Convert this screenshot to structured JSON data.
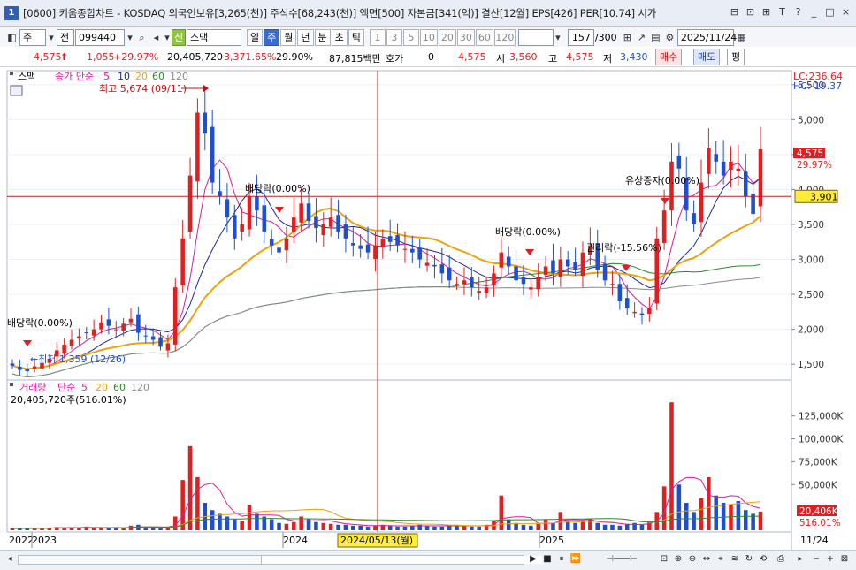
{
  "window": {
    "badge": "1",
    "title": "[0600] 키움종합차트 - KOSDAQ 외국인보유[3,265(천)] 주식수[68,243(천)] 액면[500] 자본금[341(억)] 결산[12월] EPS[426] PER[10.74] 시가",
    "buttons": [
      "⊟",
      "⊡",
      "⊞",
      "T",
      "?",
      "_",
      "□",
      "×"
    ]
  },
  "toolbar": {
    "period_mode": "주",
    "prev_label": "전",
    "stock_code": "099440",
    "credit_label": "신",
    "stock_name": "스맥",
    "period_buttons": [
      "일",
      "주",
      "월",
      "년",
      "분",
      "초",
      "틱"
    ],
    "selected_period": "주",
    "intervals": [
      "1",
      "3",
      "5",
      "10",
      "20",
      "30",
      "60",
      "120"
    ],
    "count": "157",
    "count_total": "/300",
    "date": "2025/11/24"
  },
  "quote": {
    "price": "4,575",
    "change": "1,055",
    "change_pct": "+29.97%",
    "volume": "20,405,720",
    "volume_pct": "3,371.65%",
    "turnover": "29.90%",
    "amount": "87,815백만",
    "hoga_label": "호가",
    "hoga_value": "0",
    "hoga_price": "4,575",
    "open_label": "시",
    "open": "3,560",
    "high_label": "고",
    "high": "4,575",
    "low_label": "저",
    "low": "3,430",
    "buy_label": "매수",
    "sell_label": "매도",
    "eval_label": "평"
  },
  "price_panel": {
    "stock_tag": "스맥",
    "legend_label": "종가 단순",
    "ma_labels": [
      "5",
      "10",
      "20",
      "60",
      "120"
    ],
    "ma_colors": [
      "#d81b9c",
      "#1b2a99",
      "#e8a410",
      "#2a8a2a",
      "#8a8a8a"
    ],
    "lc": "LC:236.64",
    "hc": "HC:-19.37",
    "axis_labels": [
      "5,500",
      "5,000",
      "4,500",
      "4,000",
      "3,500",
      "3,000",
      "2,500",
      "2,000",
      "1,500"
    ],
    "axis_values": [
      5500,
      5000,
      4500,
      4000,
      3500,
      3000,
      2500,
      2000,
      1500
    ],
    "current_price_label": "4,575",
    "current_pct_label": "29.97%",
    "crosshair_price_label": "3,901",
    "crosshair_price": 3901,
    "high_annotation": "최고 5,674 (09/11)",
    "low_annotation": "←최저 1,359 (12/26)",
    "events": [
      "배당락(0.00%)",
      "배당락(0.00%)",
      "배당락(0.00%)",
      "권리락(-15.56%)",
      "유상증자(0.00%)"
    ]
  },
  "volume_panel": {
    "legend_label": "거래량",
    "legend_sub": "단순",
    "ma_labels": [
      "5",
      "20",
      "60",
      "120"
    ],
    "ma_colors": [
      "#d81b9c",
      "#e8a410",
      "#2a8a2a",
      "#8a8a8a"
    ],
    "volume_text": "20,405,720주(516.01%)",
    "axis_labels": [
      "125,000K",
      "100,000K",
      "75,000K",
      "50,000K"
    ],
    "axis_values": [
      125000,
      100000,
      75000,
      50000
    ],
    "current_volume_label": "20,406K",
    "current_pct_label": "516.01%"
  },
  "x_axis": {
    "labels": [
      "2022",
      "2023",
      "2024",
      "2025"
    ],
    "crosshair_date": "2024/05/13(월)",
    "right_label": "11/24"
  },
  "chart_data": {
    "type": "candlestick",
    "interval": "weekly",
    "x_range": [
      "2022-12",
      "2025-11-24"
    ],
    "ylim": [
      1300,
      5700
    ],
    "series": [
      {
        "name": "종가",
        "close": [
          1480,
          1420,
          1400,
          1470,
          1520,
          1580,
          1700,
          1780,
          1850,
          1900,
          1950,
          2000,
          2100,
          2050,
          2000,
          2080,
          2150,
          1950,
          1900,
          1850,
          1750,
          1800,
          2600,
          3300,
          4200,
          5100,
          4800,
          4100,
          3900,
          3600,
          3300,
          3500,
          3900,
          3700,
          3400,
          3200,
          3100,
          3300,
          3600,
          3800,
          3550,
          3450,
          3500,
          3600,
          3400,
          3300,
          3200,
          3150,
          3100,
          3200,
          3300,
          3250,
          3200,
          3150,
          3100,
          3000,
          2950,
          2900,
          2800,
          2700,
          2650,
          2700,
          2600,
          2550,
          2600,
          2800,
          3100,
          2900,
          2700,
          2650,
          2600,
          2750,
          2900,
          2800,
          3000,
          2900,
          2850,
          3100,
          3200,
          2850,
          2700,
          2650,
          2400,
          2300,
          2250,
          2200,
          2300,
          3300,
          3700,
          4400,
          4300,
          3700,
          3500,
          4100,
          4600,
          4400,
          4200,
          4400,
          4300,
          3900,
          3650,
          4575
        ]
      },
      {
        "name": "거래량",
        "unit": "K",
        "values": [
          2000,
          1800,
          2200,
          2500,
          2400,
          3000,
          3500,
          2800,
          2600,
          2400,
          4000,
          3000,
          2800,
          2500,
          2600,
          2400,
          5000,
          6000,
          3000,
          2500,
          2000,
          4000,
          15000,
          55000,
          92000,
          58000,
          30000,
          22000,
          18000,
          15000,
          12000,
          10000,
          28000,
          18000,
          15000,
          12000,
          8000,
          7000,
          9000,
          15000,
          12000,
          9000,
          8000,
          7000,
          6000,
          6000,
          5000,
          5000,
          4000,
          5000,
          6000,
          5000,
          4000,
          4000,
          5000,
          6000,
          5000,
          4000,
          4000,
          5000,
          6000,
          5000,
          4000,
          4000,
          6000,
          10000,
          38000,
          12000,
          8000,
          6000,
          5000,
          7000,
          12000,
          8000,
          20000,
          10000,
          8000,
          10000,
          12000,
          8000,
          6000,
          6000,
          5000,
          7000,
          8000,
          6000,
          9000,
          20000,
          48000,
          140000,
          50000,
          30000,
          20000,
          35000,
          58000,
          38000,
          30000,
          28000,
          32000,
          22000,
          18000,
          20406
        ]
      }
    ],
    "moving_averages": [
      "5",
      "10",
      "20",
      "60",
      "120"
    ]
  }
}
